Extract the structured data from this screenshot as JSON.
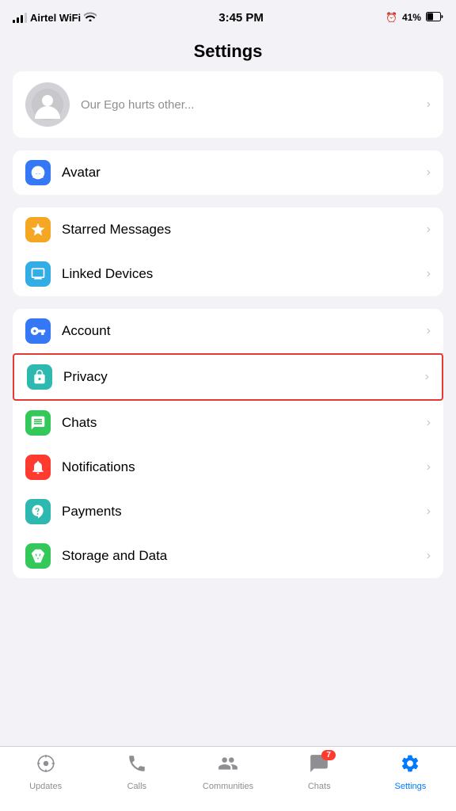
{
  "statusBar": {
    "carrier": "Airtel WiFi",
    "time": "3:45 PM",
    "battery": "41%"
  },
  "header": {
    "title": "Settings"
  },
  "profileRow": {
    "statusText": "Our Ego hurts other..."
  },
  "sections": [
    {
      "id": "avatar-section",
      "rows": [
        {
          "id": "avatar",
          "label": "Avatar",
          "iconColor": "icon-blue",
          "icon": "avatar"
        }
      ]
    },
    {
      "id": "messages-section",
      "rows": [
        {
          "id": "starred-messages",
          "label": "Starred Messages",
          "iconColor": "icon-gold",
          "icon": "star"
        },
        {
          "id": "linked-devices",
          "label": "Linked Devices",
          "iconColor": "icon-cyan",
          "icon": "devices"
        }
      ]
    },
    {
      "id": "account-section",
      "rows": [
        {
          "id": "account",
          "label": "Account",
          "iconColor": "icon-blue",
          "icon": "key"
        },
        {
          "id": "privacy",
          "label": "Privacy",
          "iconColor": "icon-teal2",
          "icon": "lock",
          "highlighted": true
        },
        {
          "id": "chats",
          "label": "Chats",
          "iconColor": "icon-teal",
          "icon": "chat"
        },
        {
          "id": "notifications",
          "label": "Notifications",
          "iconColor": "icon-red",
          "icon": "bell"
        },
        {
          "id": "payments",
          "label": "Payments",
          "iconColor": "icon-teal2",
          "icon": "rupee"
        },
        {
          "id": "storage",
          "label": "Storage and Data",
          "iconColor": "icon-green2",
          "icon": "storage"
        }
      ]
    }
  ],
  "bottomNav": {
    "items": [
      {
        "id": "updates",
        "label": "Updates",
        "icon": "updates",
        "active": false,
        "badge": null
      },
      {
        "id": "calls",
        "label": "Calls",
        "icon": "calls",
        "active": false,
        "badge": null
      },
      {
        "id": "communities",
        "label": "Communities",
        "icon": "communities",
        "active": false,
        "badge": null
      },
      {
        "id": "chats",
        "label": "Chats",
        "icon": "chats",
        "active": false,
        "badge": "7"
      },
      {
        "id": "settings",
        "label": "Settings",
        "icon": "settings",
        "active": true,
        "badge": null
      }
    ]
  }
}
